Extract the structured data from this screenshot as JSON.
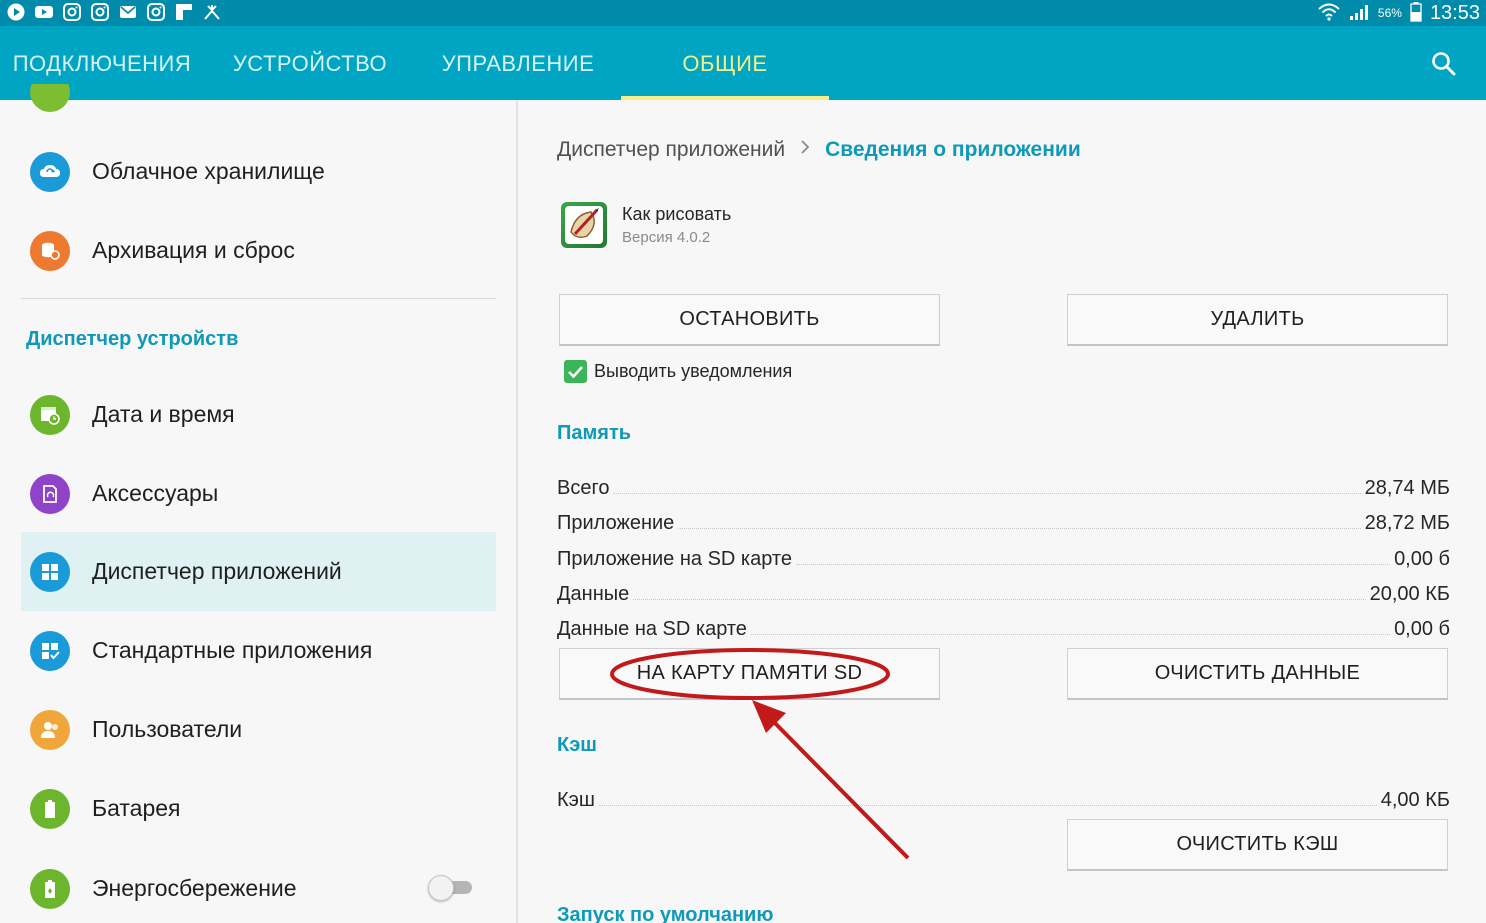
{
  "status_bar": {
    "battery_percent": "56%",
    "time": "13:53"
  },
  "tabs": [
    {
      "label": "ПОДКЛЮЧЕНИЯ",
      "active": false
    },
    {
      "label": "УСТРОЙСТВО",
      "active": false
    },
    {
      "label": "УПРАВЛЕНИЕ",
      "active": false
    },
    {
      "label": "ОБЩИЕ",
      "active": true
    }
  ],
  "sidebar": {
    "items": [
      {
        "label": "Облачное хранилище",
        "icon": "cloud-sync-icon",
        "color": "#1a9ad6"
      },
      {
        "label": "Архивация и сброс",
        "icon": "backup-reset-icon",
        "color": "#ee7a32"
      },
      {
        "label": "Дата и время",
        "icon": "calendar-clock-icon",
        "color": "#6cb52d"
      },
      {
        "label": "Аксессуары",
        "icon": "accessory-icon",
        "color": "#8e43c9"
      },
      {
        "label": "Диспетчер приложений",
        "icon": "app-grid-icon",
        "color": "#1a9ad6",
        "selected": true
      },
      {
        "label": "Стандартные приложения",
        "icon": "default-apps-icon",
        "color": "#1a9ad6"
      },
      {
        "label": "Пользователи",
        "icon": "users-icon",
        "color": "#f0a63a"
      },
      {
        "label": "Батарея",
        "icon": "battery-icon",
        "color": "#6cb52d"
      },
      {
        "label": "Энергосбережение",
        "icon": "power-saving-icon",
        "color": "#6cb52d"
      }
    ],
    "section_header": "Диспетчер устройств",
    "power_saving_toggle": false
  },
  "breadcrumb": {
    "parent": "Диспетчер приложений",
    "current": "Сведения о приложении"
  },
  "app": {
    "name": "Как рисовать",
    "version": "Версия 4.0.2"
  },
  "buttons": {
    "stop": "ОСТАНОВИТЬ",
    "uninstall": "УДАЛИТЬ",
    "move_to_sd": "НА КАРТУ ПАМЯТИ SD",
    "clear_data": "ОЧИСТИТЬ ДАННЫЕ",
    "clear_cache": "ОЧИСТИТЬ КЭШ"
  },
  "notifications": {
    "label": "Выводить уведомления",
    "checked": true
  },
  "memory": {
    "title": "Память",
    "rows": [
      {
        "label": "Всего",
        "value": "28,74 МБ"
      },
      {
        "label": "Приложение",
        "value": "28,72 МБ"
      },
      {
        "label": "Приложение на SD карте",
        "value": "0,00 б"
      },
      {
        "label": "Данные",
        "value": "20,00 КБ"
      },
      {
        "label": "Данные на SD карте",
        "value": "0,00 б"
      }
    ]
  },
  "cache": {
    "title": "Кэш",
    "label": "Кэш",
    "value": "4,00 КБ"
  },
  "default_launch": {
    "title": "Запуск по умолчанию"
  },
  "colors": {
    "header": "#00a5c3",
    "accent": "#0e99b8",
    "active_tab": "#f3f08a",
    "annotation": "#c21a1a"
  }
}
